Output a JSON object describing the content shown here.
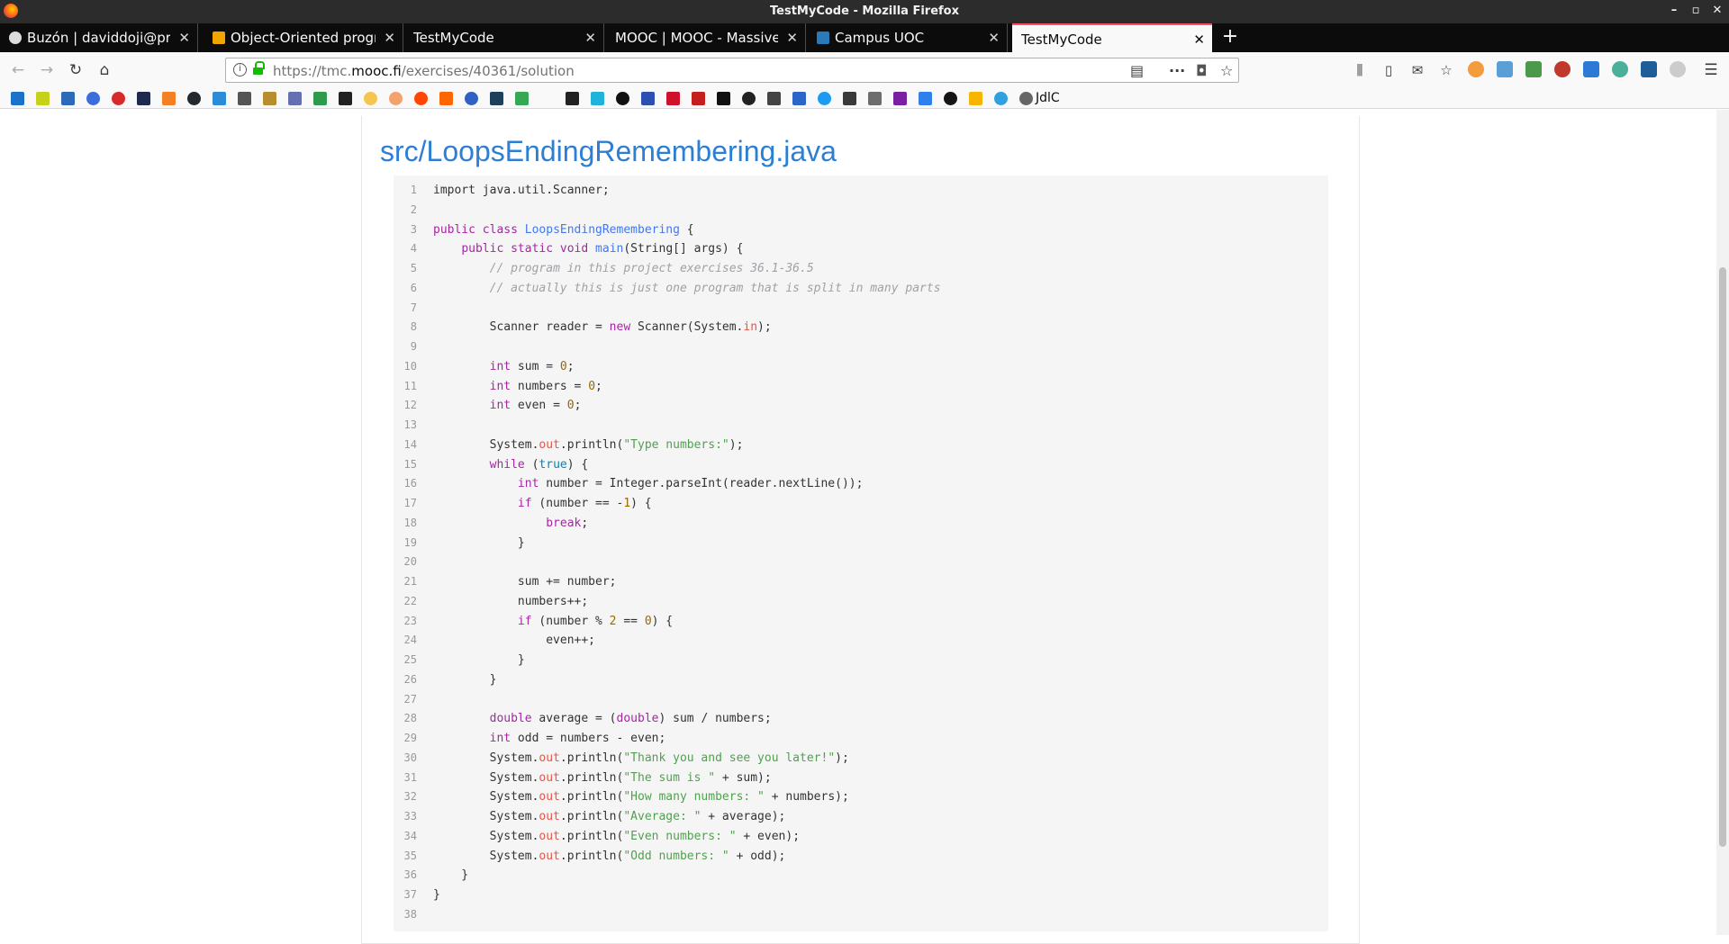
{
  "window": {
    "title": "TestMyCode - Mozilla Firefox",
    "controls": [
      "–",
      "▫",
      "✕"
    ]
  },
  "tabs": [
    {
      "label": "Buzón | daviddoji@pro",
      "active": false
    },
    {
      "label": "Object-Oriented progra",
      "active": false
    },
    {
      "label": "TestMyCode",
      "active": false
    },
    {
      "label": "MOOC | MOOC - Massive",
      "active": false
    },
    {
      "label": "Campus UOC",
      "active": false
    },
    {
      "label": "TestMyCode",
      "active": true
    }
  ],
  "new_tab": "+",
  "address": {
    "prefix": "https://tmc.",
    "domain": "mooc.fi",
    "path": "/exercises/40361/solution"
  },
  "bookmarks": {
    "last_label": "JdlC"
  },
  "page": {
    "filename": "src/LoopsEndingRemembering.java"
  },
  "code": [
    {
      "n": "1",
      "t": "import java.util.Scanner;"
    },
    {
      "n": "2",
      "t": ""
    },
    {
      "n": "3",
      "t": "public class LoopsEndingRemembering {"
    },
    {
      "n": "4",
      "t": "    public static void main(String[] args) {"
    },
    {
      "n": "5",
      "t": "        // program in this project exercises 36.1-36.5"
    },
    {
      "n": "6",
      "t": "        // actually this is just one program that is split in many parts"
    },
    {
      "n": "7",
      "t": ""
    },
    {
      "n": "8",
      "t": "        Scanner reader = new Scanner(System.in);"
    },
    {
      "n": "9",
      "t": ""
    },
    {
      "n": "10",
      "t": "        int sum = 0;"
    },
    {
      "n": "11",
      "t": "        int numbers = 0;"
    },
    {
      "n": "12",
      "t": "        int even = 0;"
    },
    {
      "n": "13",
      "t": ""
    },
    {
      "n": "14",
      "t": "        System.out.println(\"Type numbers:\");"
    },
    {
      "n": "15",
      "t": "        while (true) {"
    },
    {
      "n": "16",
      "t": "            int number = Integer.parseInt(reader.nextLine());"
    },
    {
      "n": "17",
      "t": "            if (number == -1) {"
    },
    {
      "n": "18",
      "t": "                break;"
    },
    {
      "n": "19",
      "t": "            }"
    },
    {
      "n": "20",
      "t": ""
    },
    {
      "n": "21",
      "t": "            sum += number;"
    },
    {
      "n": "22",
      "t": "            numbers++;"
    },
    {
      "n": "23",
      "t": "            if (number % 2 == 0) {"
    },
    {
      "n": "24",
      "t": "                even++;"
    },
    {
      "n": "25",
      "t": "            }"
    },
    {
      "n": "26",
      "t": "        }"
    },
    {
      "n": "27",
      "t": ""
    },
    {
      "n": "28",
      "t": "        double average = (double) sum / numbers;"
    },
    {
      "n": "29",
      "t": "        int odd = numbers - even;"
    },
    {
      "n": "30",
      "t": "        System.out.println(\"Thank you and see you later!\");"
    },
    {
      "n": "31",
      "t": "        System.out.println(\"The sum is \" + sum);"
    },
    {
      "n": "32",
      "t": "        System.out.println(\"How many numbers: \" + numbers);"
    },
    {
      "n": "33",
      "t": "        System.out.println(\"Average: \" + average);"
    },
    {
      "n": "34",
      "t": "        System.out.println(\"Even numbers: \" + even);"
    },
    {
      "n": "35",
      "t": "        System.out.println(\"Odd numbers: \" + odd);"
    },
    {
      "n": "36",
      "t": "    }"
    },
    {
      "n": "37",
      "t": "}"
    },
    {
      "n": "38",
      "t": ""
    }
  ],
  "colors": {
    "accent_tab": "#ff4f5e",
    "link": "#2c7fd4",
    "code_bg": "#f5f5f5"
  }
}
